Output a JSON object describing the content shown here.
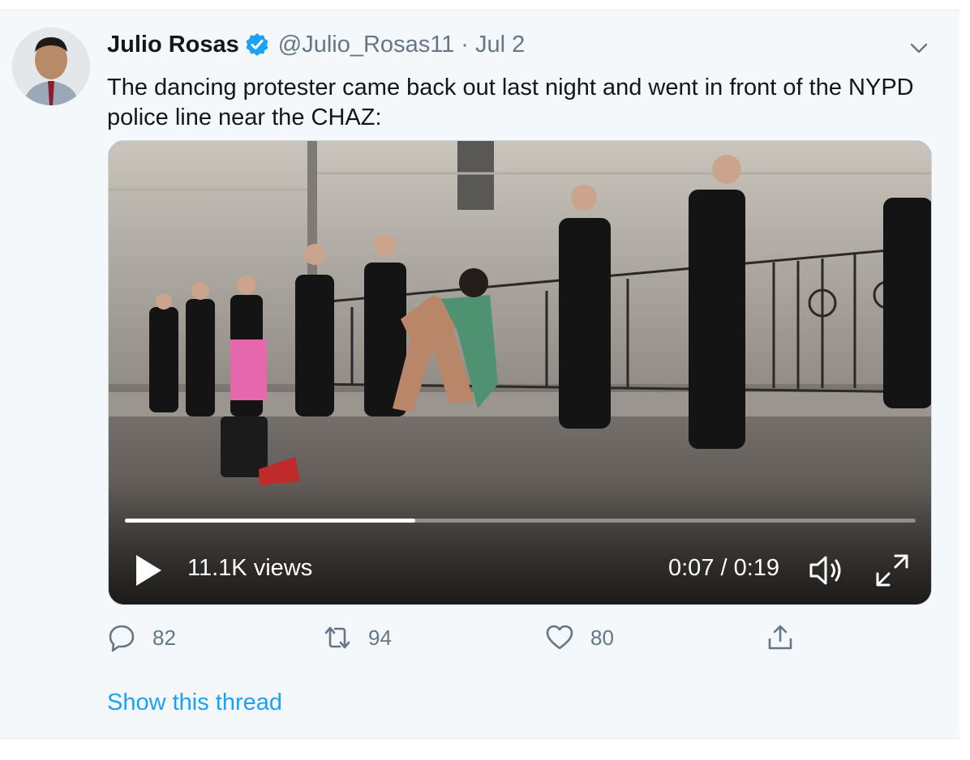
{
  "tweet": {
    "author_name": "Julio Rosas",
    "handle": "@Julio_Rosas11",
    "separator": "·",
    "date": "Jul 2",
    "text": "The dancing protester came back out last night and went in front of the NYPD police line near the CHAZ:",
    "verified_color": "#1da1f2"
  },
  "video": {
    "views": "11.1K views",
    "time": "0:07 / 0:19",
    "progress": 0.367
  },
  "actions": {
    "reply_count": "82",
    "retweet_count": "94",
    "like_count": "80"
  },
  "show_thread": "Show this thread",
  "icons": [
    "verified-badge-icon",
    "chevron-down-icon",
    "play-icon",
    "volume-icon",
    "fullscreen-icon",
    "reply-icon",
    "retweet-icon",
    "like-icon",
    "share-icon"
  ]
}
